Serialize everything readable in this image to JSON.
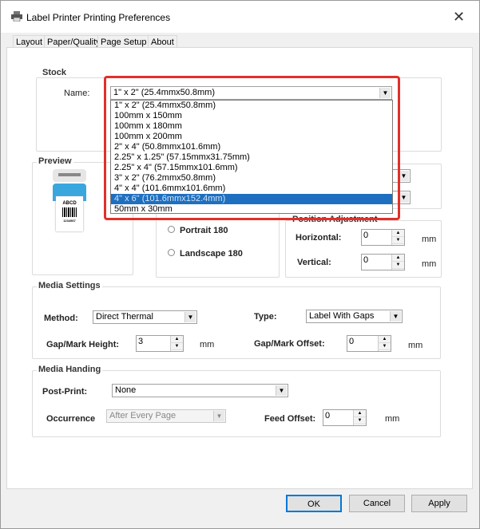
{
  "window": {
    "title": "Label Printer Printing Preferences"
  },
  "tabs": [
    {
      "label": "Layout"
    },
    {
      "label": "Paper/Quality"
    },
    {
      "label": "Page Setup"
    },
    {
      "label": "About"
    }
  ],
  "stock": {
    "group": "Stock",
    "name_label": "Name:",
    "selected": "1\" x 2\" (25.4mmx50.8mm)",
    "options": [
      "1\" x 2\" (25.4mmx50.8mm)",
      "100mm x 150mm",
      "100mm x 180mm",
      "100mm x 200mm",
      "2\" x 4\" (50.8mmx101.6mm)",
      "2.25\" x 1.25\" (57.15mmx31.75mm)",
      "2.25\" x 4\" (57.15mmx101.6mm)",
      "3\" x 2\" (76.2mmx50.8mm)",
      "4\" x 4\" (101.6mmx101.6mm)",
      "4\" x 6\" (101.6mmx152.4mm)",
      "50mm x 30mm"
    ],
    "highlighted_index": 9
  },
  "preview": {
    "group": "Preview",
    "label_text": "ABCD",
    "barcode_number": "1234567"
  },
  "orientation": {
    "portrait180": "Portrait 180",
    "landscape180": "Landscape 180"
  },
  "position": {
    "group": "Position Adjustment",
    "horizontal_label": "Horizontal:",
    "horizontal": "0",
    "vertical_label": "Vertical:",
    "vertical": "0",
    "unit": "mm"
  },
  "media": {
    "group": "Media Settings",
    "method_label": "Method:",
    "method": "Direct Thermal",
    "type_label": "Type:",
    "type": "Label With Gaps",
    "gap_height_label": "Gap/Mark Height:",
    "gap_height": "3",
    "gap_offset_label": "Gap/Mark Offset:",
    "gap_offset": "0",
    "unit": "mm"
  },
  "handling": {
    "group": "Media Handing",
    "post_print_label": "Post-Print:",
    "post_print": "None",
    "occurrence_label": "Occurrence",
    "occurrence": "After Every Page",
    "feed_offset_label": "Feed Offset:",
    "feed_offset": "0",
    "unit": "mm"
  },
  "buttons": {
    "ok": "OK",
    "cancel": "Cancel",
    "apply": "Apply"
  },
  "colors": {
    "highlight": "#1e6fbf",
    "annotation": "#e0302a"
  }
}
